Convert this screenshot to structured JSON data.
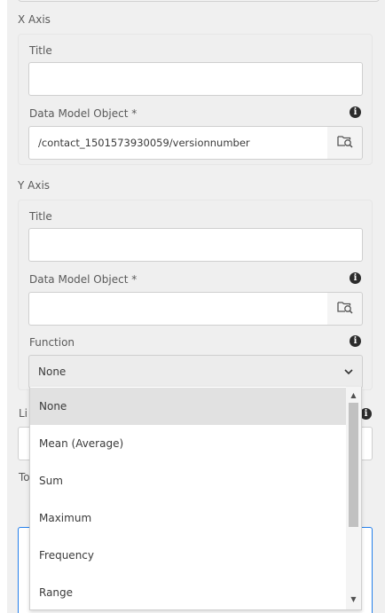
{
  "x_axis": {
    "heading": "X Axis",
    "title_label": "Title",
    "title_value": "",
    "dmo_label": "Data Model Object *",
    "dmo_value": "/contact_1501573930059/versionnumber"
  },
  "y_axis": {
    "heading": "Y Axis",
    "title_label": "Title",
    "title_value": "",
    "dmo_label": "Data Model Object *",
    "dmo_value": "",
    "function_label": "Function",
    "function_value": "None"
  },
  "obscured": {
    "label_1": "Li",
    "label_2": "To"
  },
  "function_options": [
    {
      "label": "None",
      "selected": true
    },
    {
      "label": "Mean (Average)",
      "selected": false
    },
    {
      "label": "Sum",
      "selected": false
    },
    {
      "label": "Maximum",
      "selected": false
    },
    {
      "label": "Frequency",
      "selected": false
    },
    {
      "label": "Range",
      "selected": false
    }
  ],
  "icons": {
    "info": "info-icon",
    "browse": "folder-search-icon",
    "dropdown": "chevron-down-icon",
    "scroll_up": "scroll-up-arrow-icon",
    "scroll_down": "scroll-down-arrow-icon"
  },
  "colors": {
    "panel_bg": "#f0f0f0",
    "input_bg": "#ffffff",
    "focus_border": "#2680eb",
    "selected_option_bg": "#e1e1e1"
  }
}
